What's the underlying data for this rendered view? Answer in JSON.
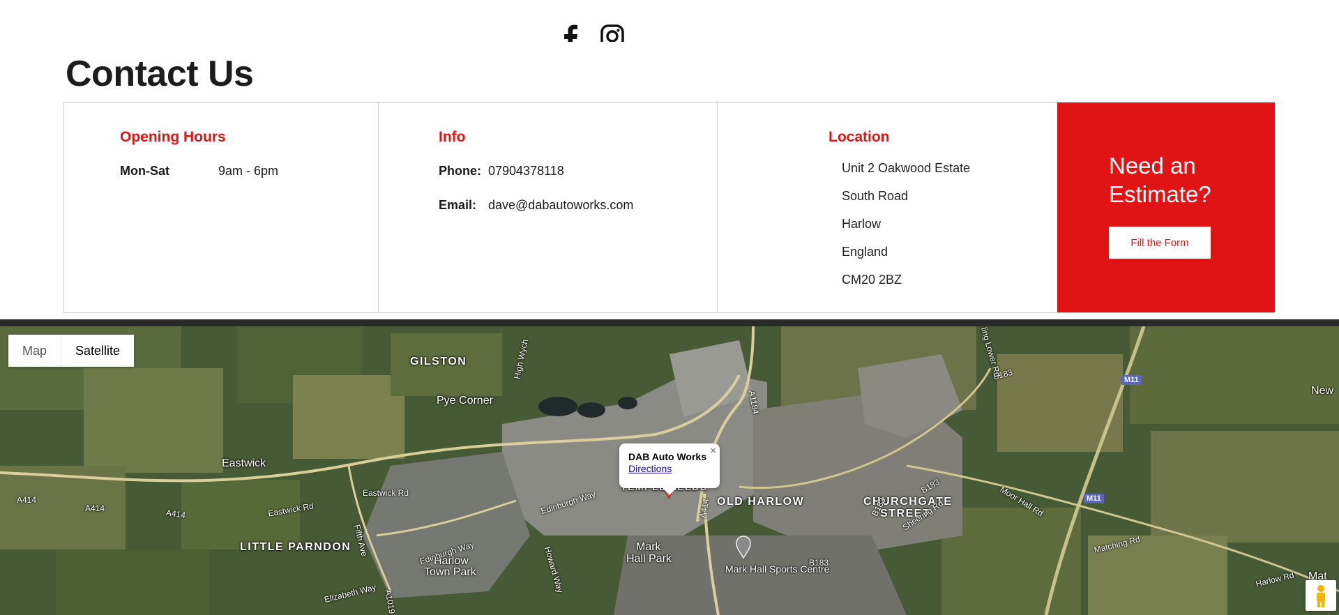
{
  "social": {
    "icons": [
      "facebook-icon",
      "instagram-icon"
    ]
  },
  "title": "Contact Us",
  "hours": {
    "heading": "Opening Hours",
    "day": "Mon-Sat",
    "time": "9am - 6pm"
  },
  "info": {
    "heading": "Info",
    "phone_label": "Phone:",
    "phone": "07904378118",
    "email_label": "Email:",
    "email": "dave@dabautoworks.com"
  },
  "location": {
    "heading": "Location",
    "lines": [
      "Unit 2 Oakwood Estate",
      "South Road",
      "Harlow",
      "England",
      "CM20 2BZ"
    ]
  },
  "cta": {
    "title_line1": "Need an",
    "title_line2": "Estimate?",
    "button": "Fill the Form"
  },
  "map": {
    "toggle": {
      "map": "Map",
      "satellite": "Satellite",
      "active": "Satellite"
    },
    "infowindow": {
      "title": "DAB Auto Works",
      "link": "Directions",
      "close": "×"
    },
    "labels": {
      "gilston": "GILSTON",
      "pye_corner": "Pye Corner",
      "eastwick": "Eastwick",
      "little_parndon": "LITTLE PARNDON",
      "old_harlow": "OLD HARLOW",
      "churchgate_1": "CHURCHGATE",
      "churchgate_2": "STREET",
      "mark_hall_1": "Mark",
      "mark_hall_2": "Hall Park",
      "harlow_town_1": "Harlow",
      "harlow_town_2": "Town Park",
      "sports_centre": "Mark Hall Sports Centre",
      "templefields": "TEMPLEFIELDS",
      "new": "New",
      "mat": "Mat"
    },
    "roads": {
      "a414_1": "A414",
      "a414_2": "A414",
      "a414_3": "A414",
      "a414_4": "A414",
      "eastwick_rd_1": "Eastwick Rd",
      "eastwick_rd_2": "Eastwick Rd",
      "edinburgh_way_1": "Edinburgh Way",
      "edinburgh_way_2": "Edinburgh Way",
      "fifth_ave": "Fifth Ave",
      "howard_way": "Howard Way",
      "elizabeth_way": "Elizabeth Way",
      "a1019": "A1019",
      "a1184": "A1184",
      "b183_1": "B183",
      "b183_2": "B183",
      "b183_3": "B183",
      "b183_4": "B183",
      "sheering_rd": "Sheering Rd",
      "moor_hall_rd": "Moor Hall Rd",
      "matching_rd": "Matching Rd",
      "harlow_rd": "Harlow Rd",
      "high_wych": "High Wych",
      "lower_rd": "ling Lower Rd",
      "m11_1": "M11",
      "m11_2": "M11"
    }
  }
}
